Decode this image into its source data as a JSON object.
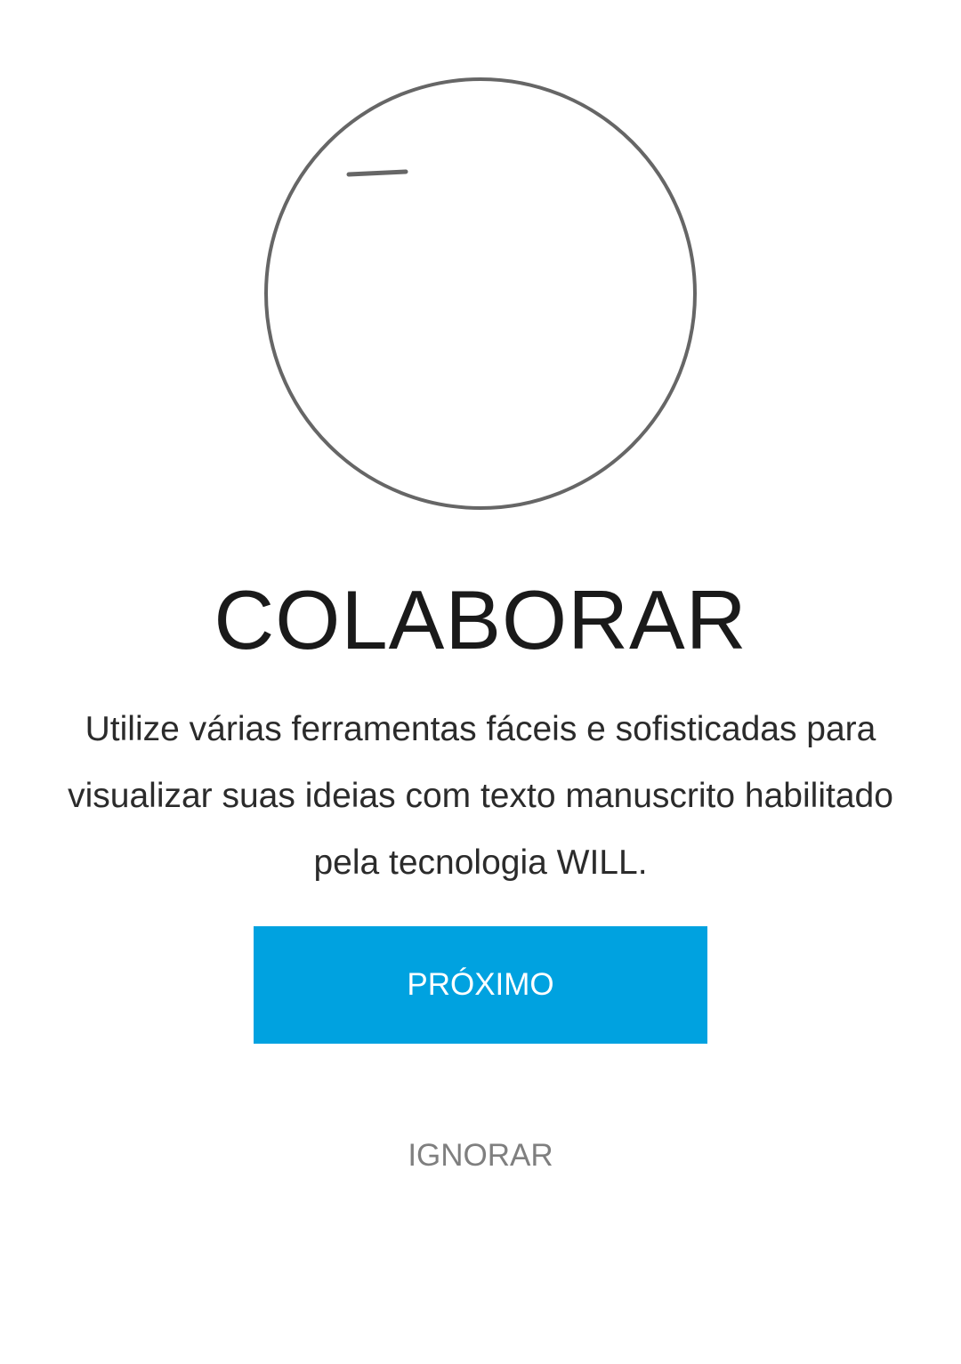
{
  "onboarding": {
    "illustration_icon": "animated-pen-stroke-circle-illustration",
    "title": "COLABORAR",
    "description": "Utilize várias ferramentas fáceis e sofisticadas para visualizar suas ideias com texto manuscrito habilitado pela tecnologia WILL.",
    "next_label": "PRÓXIMO",
    "skip_label": "IGNORAR"
  },
  "colors": {
    "accent": "#00a2e0",
    "title_text": "#1a1a1a",
    "body_text": "#2b2b2b",
    "secondary_text": "#7f7f7f",
    "illustration_stroke": "#666666"
  }
}
